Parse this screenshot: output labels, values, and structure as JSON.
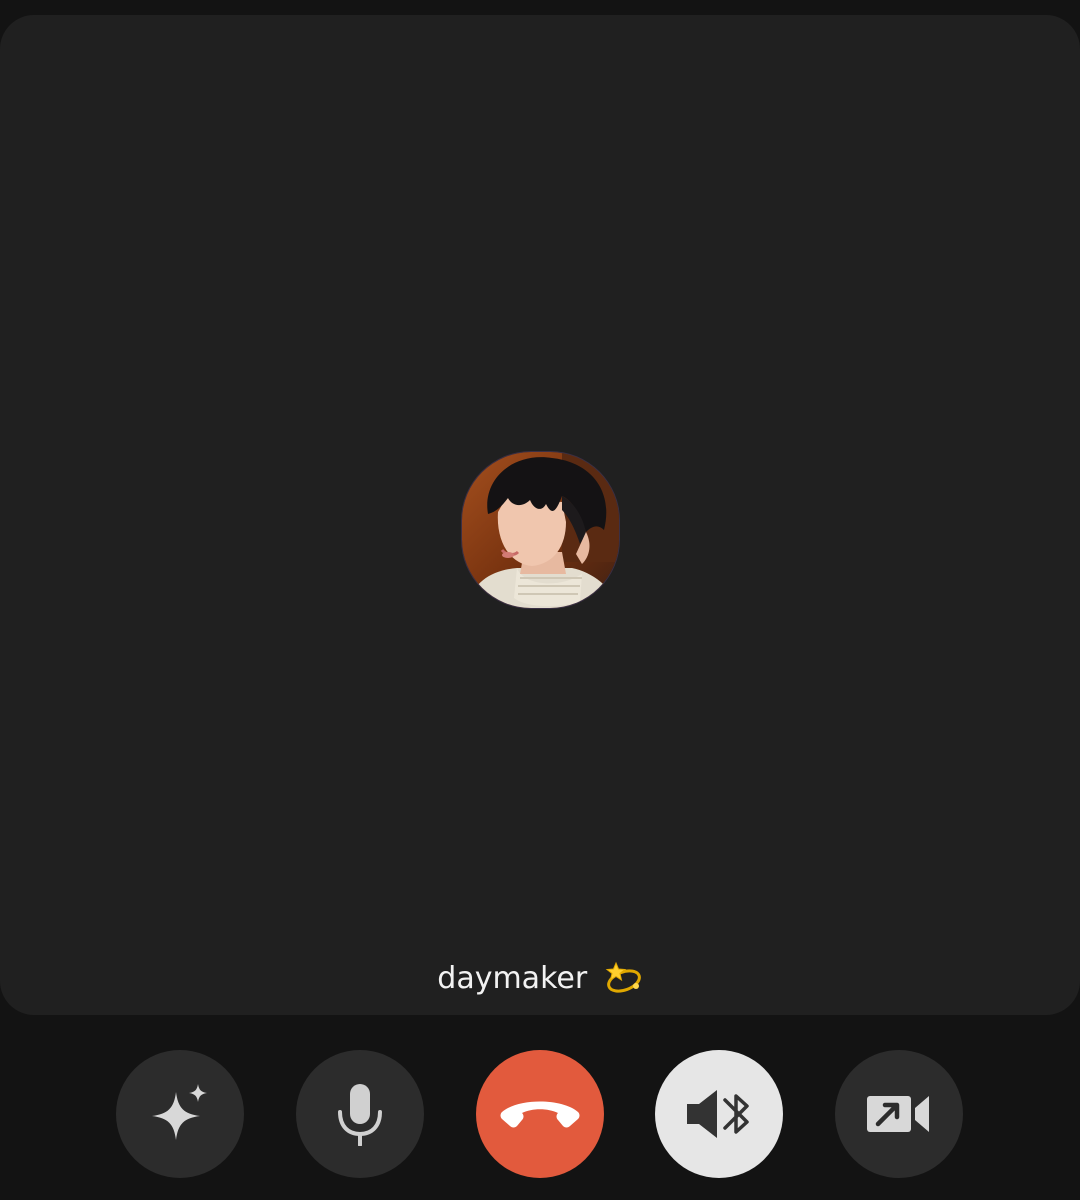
{
  "call": {
    "caller_name": "daymaker",
    "caller_emoji": "dizzy-emoji"
  },
  "controls": [
    {
      "id": "effects",
      "icon": "sparkle-icon"
    },
    {
      "id": "microphone",
      "icon": "microphone-icon"
    },
    {
      "id": "end-call",
      "icon": "hang-up-phone-icon",
      "color": "#e25a3d"
    },
    {
      "id": "audio-output",
      "icon": "bluetooth-speaker-icon",
      "color": "#e6e6e6"
    },
    {
      "id": "switch-to-video",
      "icon": "video-camera-share-icon"
    }
  ],
  "colors": {
    "background": "#131313",
    "card": "#202020",
    "button": "#2c2c2c",
    "end_call": "#e25a3d",
    "active_button": "#e6e6e6"
  }
}
